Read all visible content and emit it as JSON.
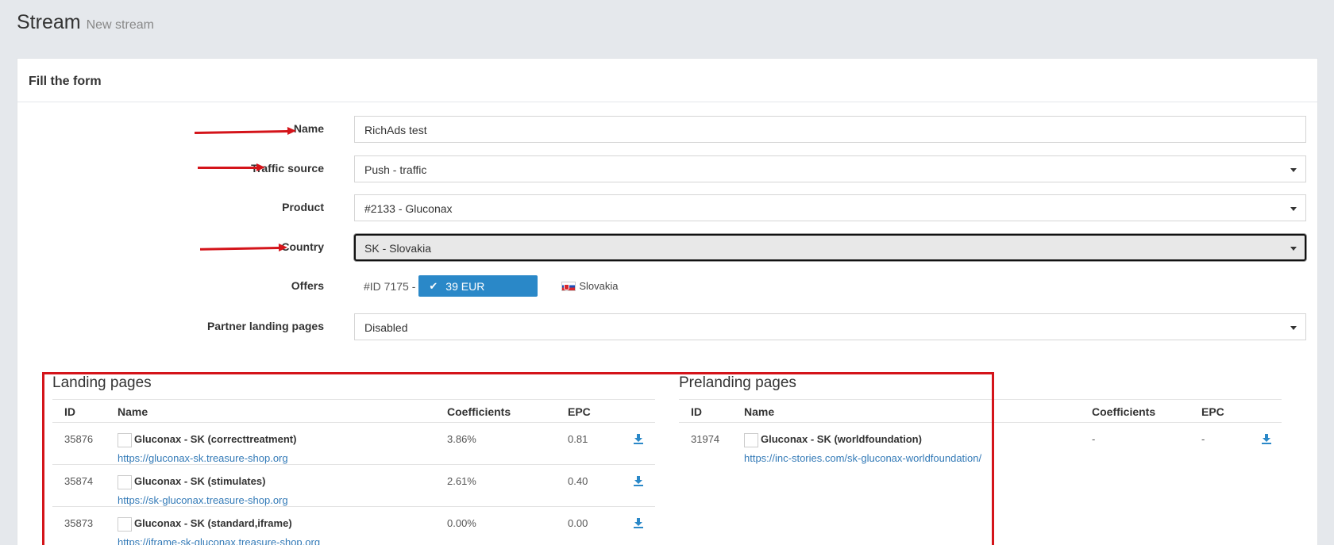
{
  "header": {
    "title": "Stream",
    "subtitle": "New stream"
  },
  "panel": {
    "heading": "Fill the form"
  },
  "form": {
    "name": {
      "label": "Name",
      "value": "RichAds test"
    },
    "traffic_source": {
      "label": "Traffic source",
      "value": "Push - traffic"
    },
    "product": {
      "label": "Product",
      "value": "#2133 - Gluconax"
    },
    "country": {
      "label": "Country",
      "value": "SK - Slovakia"
    },
    "offers": {
      "label": "Offers",
      "id_text": "#ID 7175 -",
      "price": "39 EUR",
      "country": "Slovakia"
    },
    "partner_landing_pages": {
      "label": "Partner landing pages",
      "value": "Disabled"
    }
  },
  "landing": {
    "title": "Landing pages",
    "columns": {
      "id": "ID",
      "name": "Name",
      "coefficients": "Coefficients",
      "epc": "EPC"
    },
    "rows": [
      {
        "id": "35876",
        "name": "Gluconax - SK (correcttreatment)",
        "url": "https://gluconax-sk.treasure-shop.org",
        "coefficient": "3.86%",
        "epc": "0.81"
      },
      {
        "id": "35874",
        "name": "Gluconax - SK (stimulates)",
        "url": "https://sk-gluconax.treasure-shop.org",
        "coefficient": "2.61%",
        "epc": "0.40"
      },
      {
        "id": "35873",
        "name": "Gluconax - SK (standard,iframe)",
        "url": "https://iframe-sk-gluconax.treasure-shop.org",
        "coefficient": "0.00%",
        "epc": "0.00"
      }
    ]
  },
  "prelanding": {
    "title": "Prelanding pages",
    "columns": {
      "id": "ID",
      "name": "Name",
      "coefficients": "Coefficients",
      "epc": "EPC"
    },
    "rows": [
      {
        "id": "31974",
        "name": "Gluconax - SK (worldfoundation)",
        "url": "https://inc-stories.com/sk-gluconax-worldfoundation/",
        "coefficient": "-",
        "epc": "-"
      }
    ]
  },
  "icons": {
    "download": "download-icon",
    "check": "check-icon",
    "flag": "slovakia-flag-icon",
    "dropdown": "caret-down-icon"
  },
  "colors": {
    "accent": "#2a88c8",
    "annotation": "#d4141a",
    "link": "#337ab7"
  }
}
